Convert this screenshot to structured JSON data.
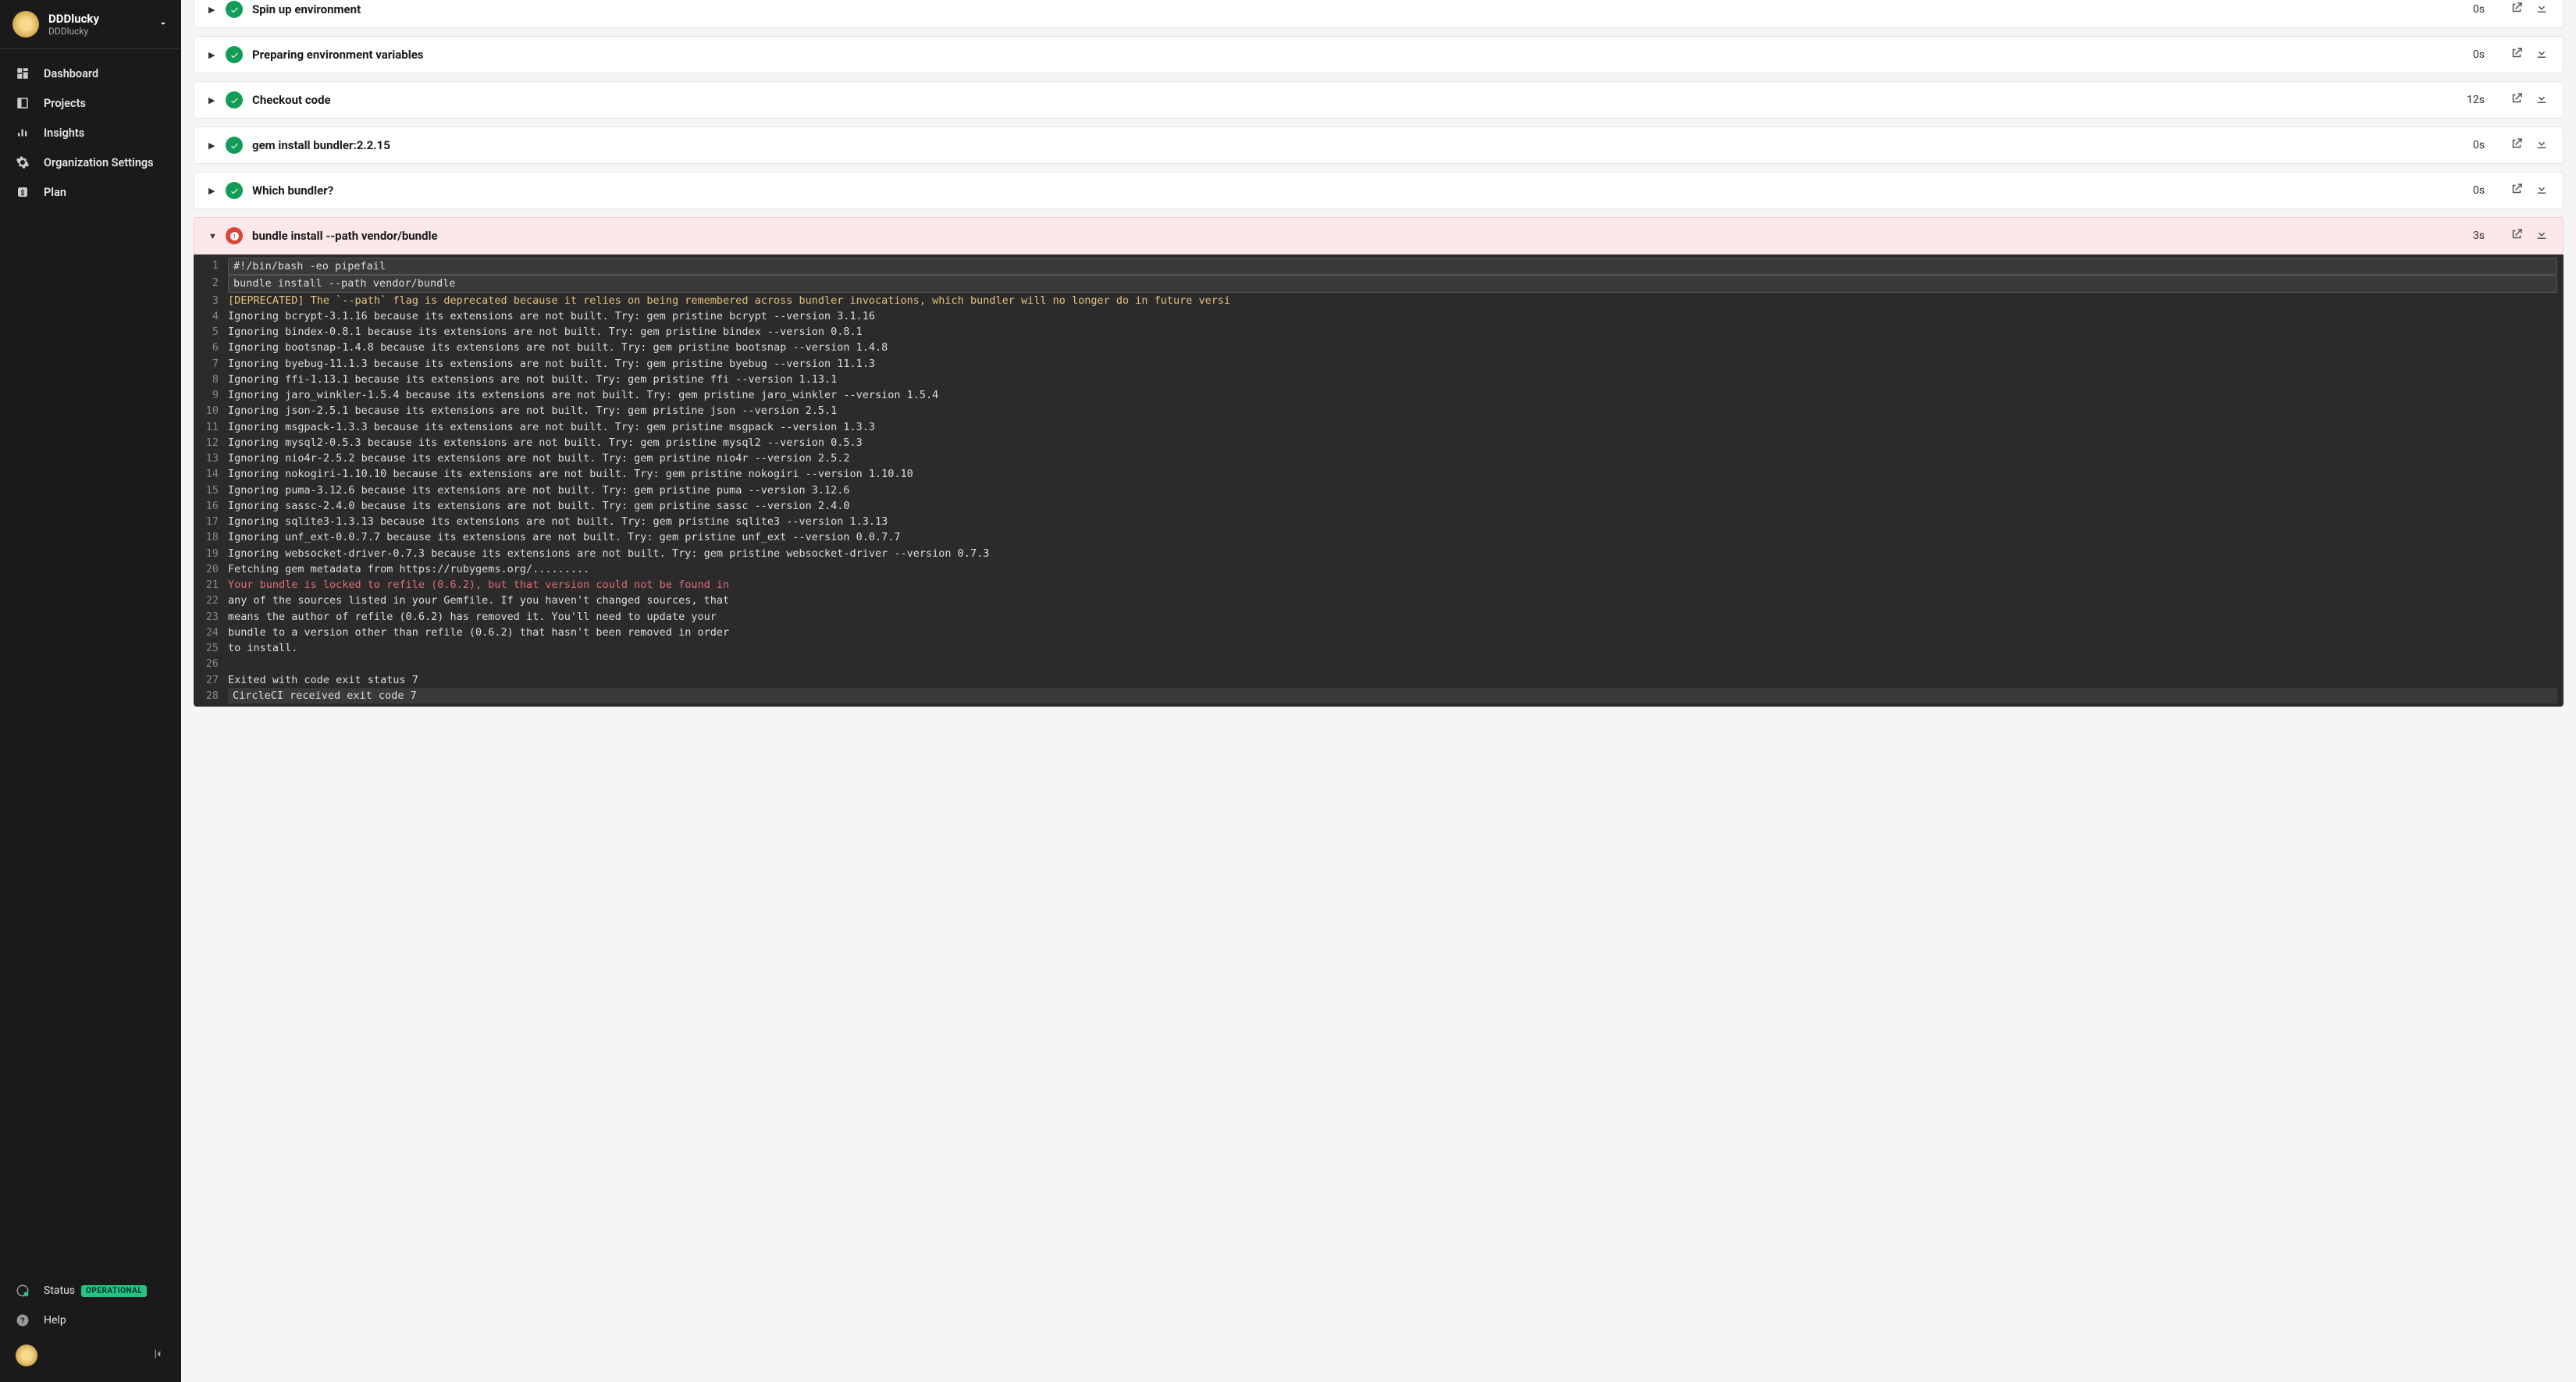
{
  "org": {
    "name": "DDDlucky",
    "sub": "DDDlucky"
  },
  "nav": [
    {
      "key": "dashboard",
      "label": "Dashboard"
    },
    {
      "key": "projects",
      "label": "Projects"
    },
    {
      "key": "insights",
      "label": "Insights"
    },
    {
      "key": "org-settings",
      "label": "Organization Settings"
    },
    {
      "key": "plan",
      "label": "Plan"
    }
  ],
  "footer": {
    "status": {
      "label": "Status",
      "badge": "OPERATIONAL"
    },
    "help": {
      "label": "Help"
    }
  },
  "steps": [
    {
      "key": "spin-up",
      "label": "Spin up environment",
      "time": "0s",
      "status": "ok",
      "expanded": false,
      "cut": true
    },
    {
      "key": "env-vars",
      "label": "Preparing environment variables",
      "time": "0s",
      "status": "ok",
      "expanded": false
    },
    {
      "key": "checkout",
      "label": "Checkout code",
      "time": "12s",
      "status": "ok",
      "expanded": false
    },
    {
      "key": "gem-install",
      "label": "gem install bundler:2.2.15",
      "time": "0s",
      "status": "ok",
      "expanded": false
    },
    {
      "key": "which-bundler",
      "label": "Which bundler?",
      "time": "0s",
      "status": "ok",
      "expanded": false
    },
    {
      "key": "bundle-install",
      "label": "bundle install --path vendor/bundle",
      "time": "3s",
      "status": "err",
      "expanded": true
    }
  ],
  "log": [
    {
      "n": 1,
      "cls": "cmd",
      "t": "#!/bin/bash -eo pipefail"
    },
    {
      "n": 2,
      "cls": "cmd",
      "t": "bundle install --path vendor/bundle"
    },
    {
      "n": null,
      "cls": "",
      "t": ""
    },
    {
      "n": 3,
      "cls": "warn",
      "t": "[DEPRECATED] The `--path` flag is deprecated because it relies on being remembered across bundler invocations, which bundler will no longer do in future versi"
    },
    {
      "n": 4,
      "cls": "",
      "t": "Ignoring bcrypt-3.1.16 because its extensions are not built. Try: gem pristine bcrypt --version 3.1.16"
    },
    {
      "n": 5,
      "cls": "",
      "t": "Ignoring bindex-0.8.1 because its extensions are not built. Try: gem pristine bindex --version 0.8.1"
    },
    {
      "n": 6,
      "cls": "",
      "t": "Ignoring bootsnap-1.4.8 because its extensions are not built. Try: gem pristine bootsnap --version 1.4.8"
    },
    {
      "n": 7,
      "cls": "",
      "t": "Ignoring byebug-11.1.3 because its extensions are not built. Try: gem pristine byebug --version 11.1.3"
    },
    {
      "n": 8,
      "cls": "",
      "t": "Ignoring ffi-1.13.1 because its extensions are not built. Try: gem pristine ffi --version 1.13.1"
    },
    {
      "n": 9,
      "cls": "",
      "t": "Ignoring jaro_winkler-1.5.4 because its extensions are not built. Try: gem pristine jaro_winkler --version 1.5.4"
    },
    {
      "n": 10,
      "cls": "",
      "t": "Ignoring json-2.5.1 because its extensions are not built. Try: gem pristine json --version 2.5.1"
    },
    {
      "n": 11,
      "cls": "",
      "t": "Ignoring msgpack-1.3.3 because its extensions are not built. Try: gem pristine msgpack --version 1.3.3"
    },
    {
      "n": 12,
      "cls": "",
      "t": "Ignoring mysql2-0.5.3 because its extensions are not built. Try: gem pristine mysql2 --version 0.5.3"
    },
    {
      "n": 13,
      "cls": "",
      "t": "Ignoring nio4r-2.5.2 because its extensions are not built. Try: gem pristine nio4r --version 2.5.2"
    },
    {
      "n": 14,
      "cls": "",
      "t": "Ignoring nokogiri-1.10.10 because its extensions are not built. Try: gem pristine nokogiri --version 1.10.10"
    },
    {
      "n": 15,
      "cls": "",
      "t": "Ignoring puma-3.12.6 because its extensions are not built. Try: gem pristine puma --version 3.12.6"
    },
    {
      "n": 16,
      "cls": "",
      "t": "Ignoring sassc-2.4.0 because its extensions are not built. Try: gem pristine sassc --version 2.4.0"
    },
    {
      "n": 17,
      "cls": "",
      "t": "Ignoring sqlite3-1.3.13 because its extensions are not built. Try: gem pristine sqlite3 --version 1.3.13"
    },
    {
      "n": 18,
      "cls": "",
      "t": "Ignoring unf_ext-0.0.7.7 because its extensions are not built. Try: gem pristine unf_ext --version 0.0.7.7"
    },
    {
      "n": 19,
      "cls": "",
      "t": "Ignoring websocket-driver-0.7.3 because its extensions are not built. Try: gem pristine websocket-driver --version 0.7.3"
    },
    {
      "n": 20,
      "cls": "",
      "t": "Fetching gem metadata from https://rubygems.org/........."
    },
    {
      "n": 21,
      "cls": "errln",
      "t": "Your bundle is locked to refile (0.6.2), but that version could not be found in"
    },
    {
      "n": 22,
      "cls": "",
      "t": "any of the sources listed in your Gemfile. If you haven't changed sources, that"
    },
    {
      "n": 23,
      "cls": "",
      "t": "means the author of refile (0.6.2) has removed it. You'll need to update your"
    },
    {
      "n": 24,
      "cls": "",
      "t": "bundle to a version other than refile (0.6.2) that hasn't been removed in order"
    },
    {
      "n": 25,
      "cls": "",
      "t": "to install."
    },
    {
      "n": 26,
      "cls": "",
      "t": ""
    },
    {
      "n": 27,
      "cls": "",
      "t": "Exited with code exit status 7"
    },
    {
      "n": 28,
      "cls": "final",
      "t": "CircleCI received exit code 7"
    }
  ]
}
